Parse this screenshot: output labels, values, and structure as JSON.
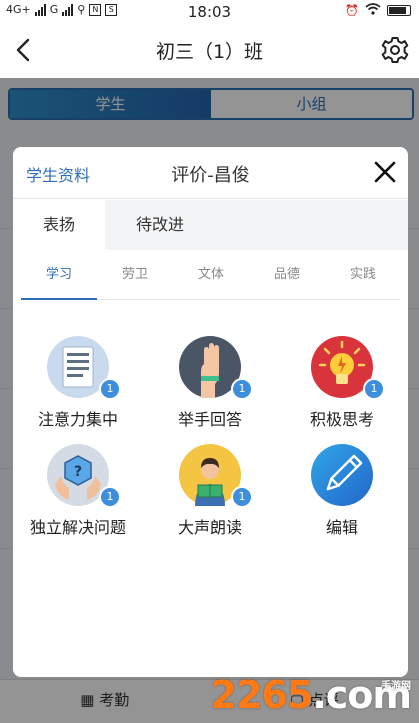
{
  "status_bar": {
    "network_1": "4G+",
    "network_2": "G",
    "app_badge_1": "N",
    "app_badge_2": "S",
    "time": "18:03"
  },
  "header": {
    "title": "初三（1）班"
  },
  "segment": {
    "items": [
      "学生",
      "小组"
    ],
    "selected": "学生"
  },
  "bottom_bar": {
    "items": [
      "考勤",
      "点评"
    ]
  },
  "dialog": {
    "link_label": "学生资料",
    "title": "评价-昌俊",
    "tabs": [
      "表扬",
      "待改进"
    ],
    "active_tab": "表扬",
    "subtabs": [
      "学习",
      "劳卫",
      "文体",
      "品德",
      "实践"
    ],
    "active_subtab": "学习",
    "items": [
      {
        "label": "注意力集中",
        "badge": "1",
        "icon": "document-icon"
      },
      {
        "label": "举手回答",
        "badge": "1",
        "icon": "raised-hand-icon"
      },
      {
        "label": "积极思考",
        "badge": "1",
        "icon": "lightbulb-icon"
      },
      {
        "label": "独立解决问题",
        "badge": "1",
        "icon": "question-cube-icon"
      },
      {
        "label": "大声朗读",
        "badge": "1",
        "icon": "reading-person-icon"
      },
      {
        "label": "编辑",
        "badge": "",
        "icon": "pencil-icon"
      }
    ]
  },
  "watermark": {
    "main_prefix": "2265",
    "main_suffix": ".com",
    "sub": "手游网"
  }
}
